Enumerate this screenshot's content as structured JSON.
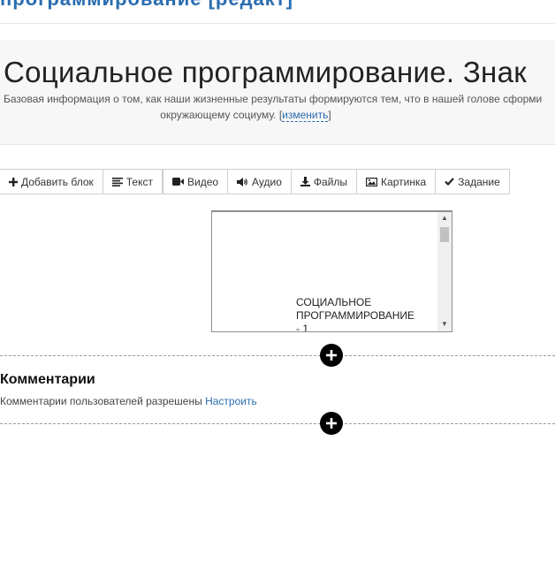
{
  "page": {
    "breadcrumb_partial": "программирование [редакт]",
    "title": "Социальное программирование. Знак",
    "description_line1": "Базовая информация о том, как наши жизненные результаты формируются тем, что в нашей голове сформи",
    "description_line2": "окружающему социуму.",
    "edit_link": "изменить"
  },
  "toolbar": {
    "items": [
      {
        "label": "Добавить блок",
        "icon": "plus-icon"
      },
      {
        "label": "Текст",
        "icon": "align-left-icon"
      },
      {
        "label": "Видео",
        "icon": "video-camera-icon"
      },
      {
        "label": "Аудио",
        "icon": "speaker-icon"
      },
      {
        "label": "Файлы",
        "icon": "download-icon"
      },
      {
        "label": "Картинка",
        "icon": "image-icon"
      },
      {
        "label": "Задание",
        "icon": "check-icon"
      }
    ]
  },
  "embed": {
    "text_line1": "СОЦИАЛЬНОЕ",
    "text_line2": "ПРОГРАММИРОВАНИЕ",
    "text_line3": "- 1"
  },
  "comments": {
    "title": "Комментарии",
    "status": "Комментарии пользователей разрешены",
    "configure_link": "Настроить"
  }
}
